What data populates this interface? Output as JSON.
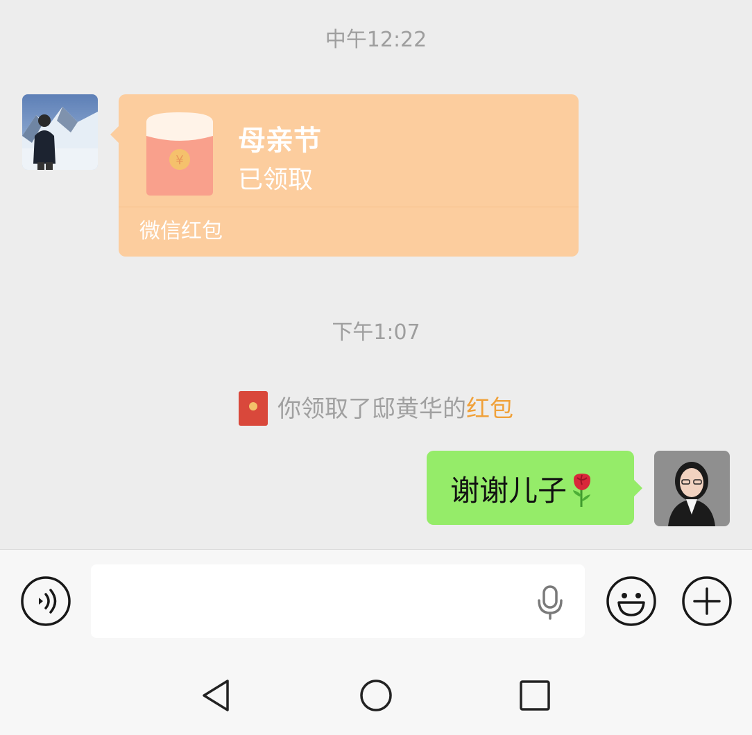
{
  "messages": {
    "time1": "中午12:22",
    "red_packet": {
      "title": "母亲节",
      "status": "已领取",
      "label": "微信红包"
    },
    "time2": "下午1:07",
    "system": {
      "text": "你领取了邸黄华的",
      "link": "红包"
    },
    "outgoing": {
      "text": "谢谢儿子"
    }
  },
  "input": {
    "placeholder": ""
  },
  "icons": {
    "voice": "voice-mode-icon",
    "mic": "microphone-icon",
    "emoji": "emoji-icon",
    "plus": "more-plus-icon",
    "back": "nav-back-icon",
    "home": "nav-home-icon",
    "recents": "nav-recents-icon"
  },
  "colors": {
    "chat_bg": "#ededed",
    "red_packet_bg": "#fccd9e",
    "outgoing_bubble": "#95ec69",
    "link": "#f0a13a",
    "timestamp": "#9e9e9e"
  }
}
